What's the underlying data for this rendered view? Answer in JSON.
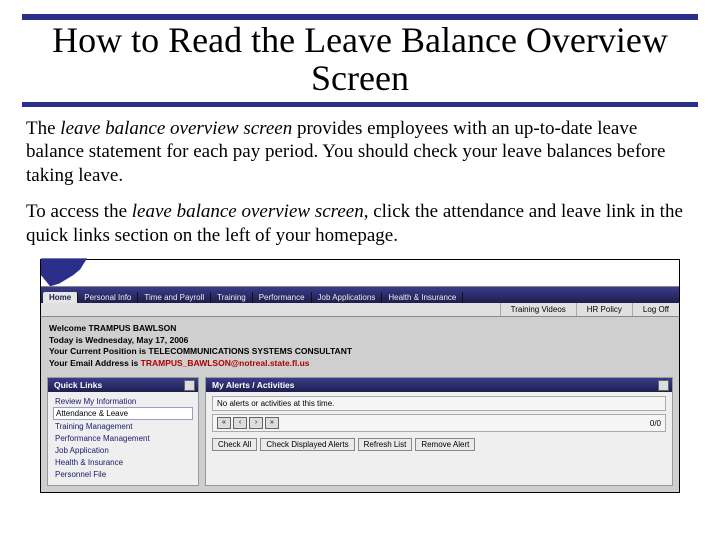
{
  "title": "How to Read the Leave Balance Overview Screen",
  "para1": {
    "pre": "The ",
    "ital": "leave balance overview screen",
    "post": " provides employees with an up-to-date leave balance statement for each pay period.  You should check your leave balances before taking leave."
  },
  "para2": {
    "pre": "To access the ",
    "ital": "leave balance overview screen",
    "post": ", click the attendance and leave link in the quick links section on the left of your homepage."
  },
  "app": {
    "tabs": [
      "Home",
      "Personal Info",
      "Time and Payroll",
      "Training",
      "Performance",
      "Job Applications",
      "Health & Insurance"
    ],
    "subbar": [
      "Training Videos",
      "HR Policy",
      "Log Off"
    ],
    "welcome": {
      "line1_label": "Welcome ",
      "line1_name": "TRAMPUS BAWLSON",
      "line2_label": "Today is ",
      "line2_value": "Wednesday, May 17, 2006",
      "line3_label": "Your Current Position is ",
      "line3_value": "TELECOMMUNICATIONS SYSTEMS CONSULTANT",
      "line4_label": "Your Email Address is ",
      "line4_value": "TRAMPUS_BAWLSON@notreal.state.fl.us"
    },
    "quicklinks": {
      "header": "Quick Links",
      "items": [
        "Review My Information",
        "Attendance & Leave",
        "Training Management",
        "Performance Management",
        "Job Application",
        "Health & Insurance",
        "Personnel File"
      ],
      "highlighted_index": 1
    },
    "alerts": {
      "header": "My Alerts / Activities",
      "empty": "No alerts or activities at this time.",
      "counter": "0/0",
      "buttons": [
        "Check All",
        "Check Displayed Alerts",
        "Refresh List",
        "Remove Alert"
      ]
    }
  }
}
